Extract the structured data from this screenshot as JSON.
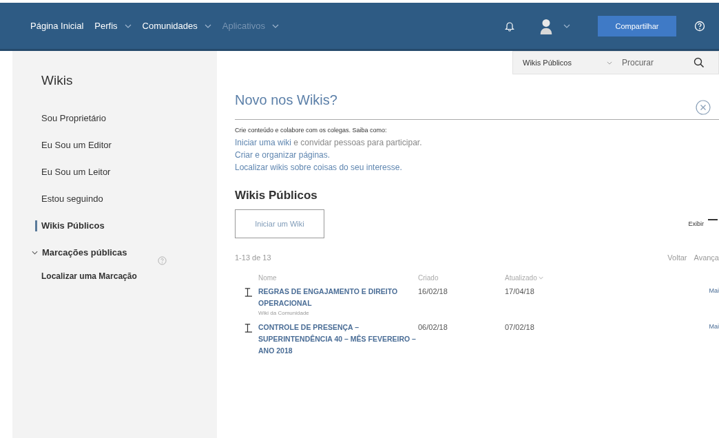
{
  "nav": {
    "items": [
      {
        "label": "Página Inicial",
        "dropdown": false,
        "disabled": false
      },
      {
        "label": "Perfis",
        "dropdown": true,
        "disabled": false
      },
      {
        "label": "Comunidades",
        "dropdown": true,
        "disabled": false
      },
      {
        "label": "Aplicativos",
        "dropdown": true,
        "disabled": true
      }
    ],
    "share_button": "Compartilhar"
  },
  "search": {
    "scope": "Wikis Públicos",
    "placeholder": "Procurar"
  },
  "sidebar": {
    "title": "Wikis",
    "items": [
      {
        "label": "Sou Proprietário",
        "selected": false
      },
      {
        "label": "Eu Sou um Editor",
        "selected": false
      },
      {
        "label": "Eu Sou um Leitor",
        "selected": false
      },
      {
        "label": "Estou seguindo",
        "selected": false
      },
      {
        "label": "Wikis Públicos",
        "selected": true
      }
    ],
    "tags_section": {
      "label": "Marcações públicas",
      "expanded": true,
      "link": "Localizar uma Marcação"
    }
  },
  "intro": {
    "title": "Novo nos Wikis?",
    "lead": "Crie conteúdo e colabore com os colegas. Saiba como:",
    "lines": [
      {
        "link": "Iniciar uma wiki",
        "rest": " e convidar pessoas para participar."
      },
      {
        "link": "Criar e organizar páginas."
      },
      {
        "link": "Localizar wikis sobre coisas do seu interesse."
      }
    ]
  },
  "list": {
    "title": "Wikis Públicos",
    "start_button": "Iniciar um Wiki",
    "show_label": "Exibir",
    "count": "1-13 de 13",
    "back": "Voltar",
    "forward": "Avança",
    "columns": [
      "Nome",
      "Criado",
      "Atualizado"
    ],
    "rows": [
      {
        "name": "REGRAS DE ENGAJAMENTO E DIREITO OPERACIONAL",
        "tag": "Wiki da Comunidade",
        "created": "16/02/18",
        "updated": "17/04/18",
        "more": "Mai"
      },
      {
        "name": "CONTROLE DE PRESENÇA – SUPERINTENDÊNCIA 40 – MÊS FEVEREIRO – ANO 2018",
        "created": "06/02/18",
        "updated": "07/02/18",
        "more": "Mai"
      }
    ]
  }
}
